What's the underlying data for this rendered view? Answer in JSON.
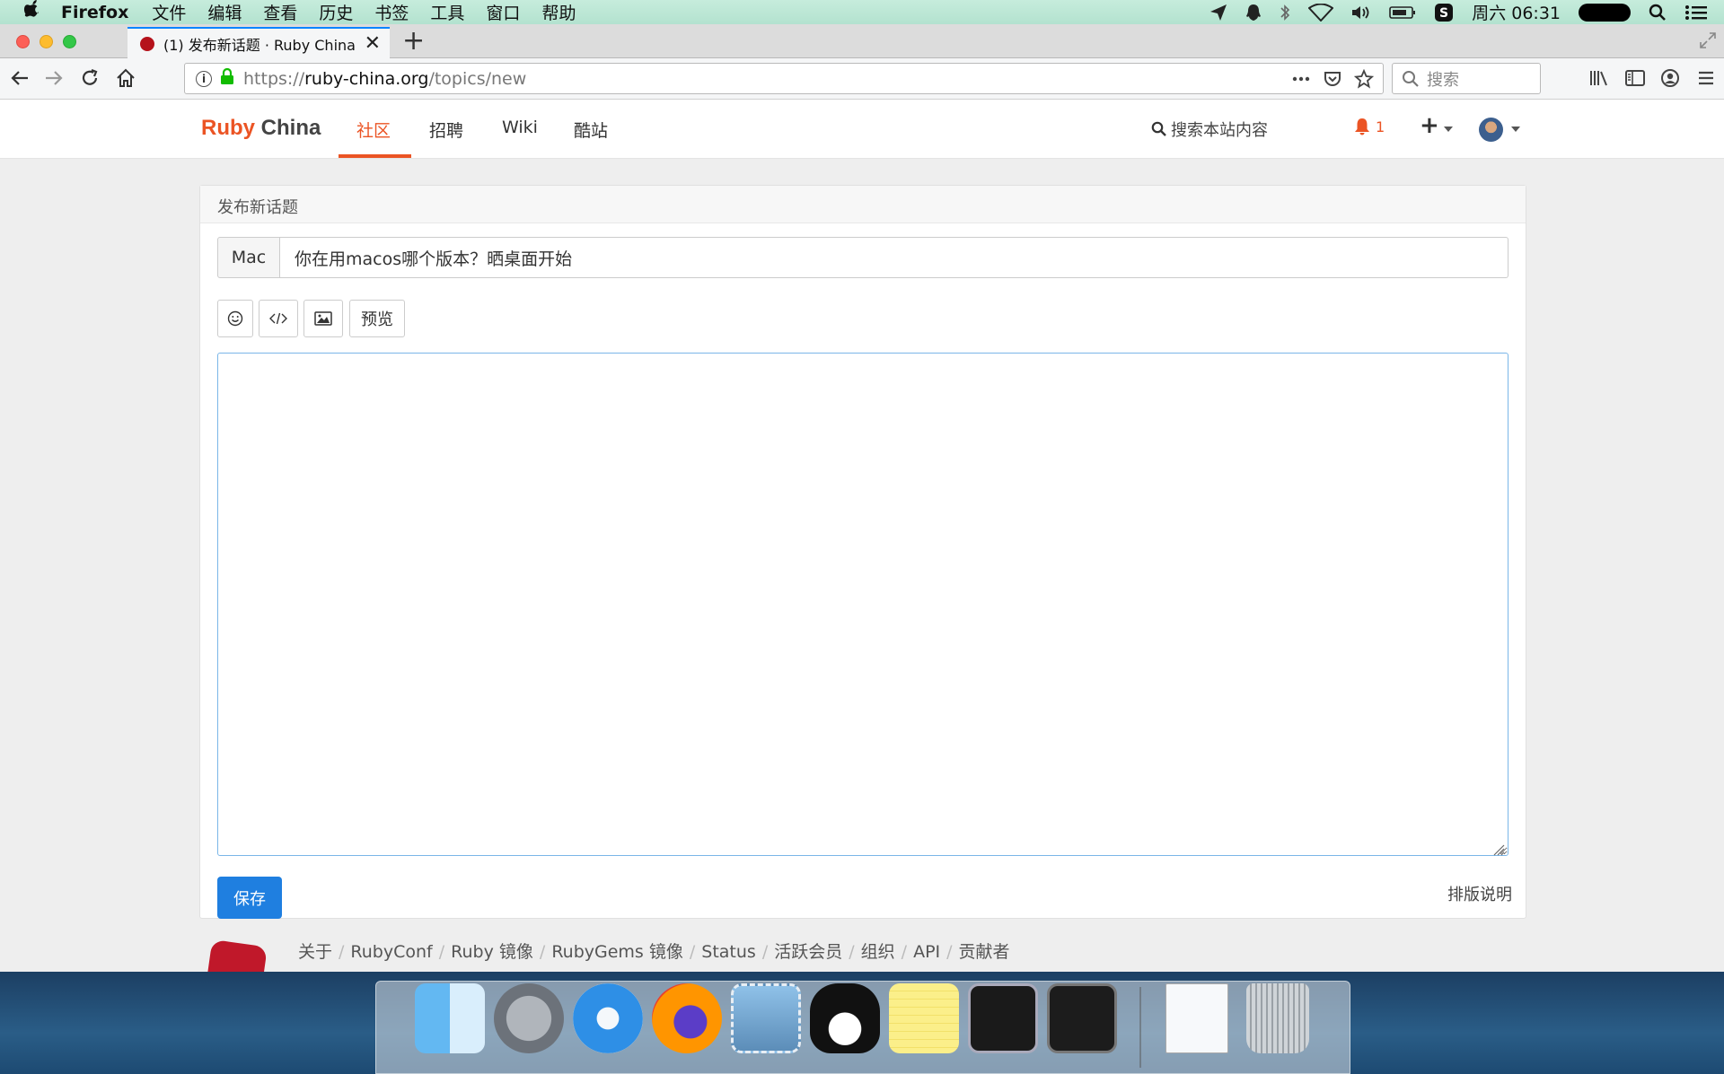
{
  "menubar": {
    "app_name": "Firefox",
    "menus": [
      "文件",
      "编辑",
      "查看",
      "历史",
      "书签",
      "工具",
      "窗口",
      "帮助"
    ],
    "clock": "周六 06:31"
  },
  "tab": {
    "title": "(1) 发布新话题 · Ruby China"
  },
  "urlbar": {
    "scheme": "https://",
    "host": "ruby-china.org",
    "path": "/topics/new"
  },
  "searchbar": {
    "placeholder": "搜索"
  },
  "site": {
    "brand_ruby": "Ruby",
    "brand_china": "China",
    "nav": [
      "社区",
      "招聘",
      "Wiki",
      "酷站"
    ],
    "search_label": "搜索本站内容",
    "notification_count": "1"
  },
  "form": {
    "card_title": "发布新话题",
    "node": "Mac",
    "title_value": "你在用macos哪个版本？晒桌面开始",
    "preview_label": "预览",
    "save_label": "保存",
    "format_help": "排版说明"
  },
  "footer": {
    "links": [
      "关于",
      "RubyConf",
      "Ruby 镜像",
      "RubyGems 镜像",
      "Status",
      "活跃会员",
      "组织",
      "API",
      "贡献者"
    ]
  },
  "colors": {
    "accent": "#eb5424",
    "primary_button": "#1f7fe0",
    "firefox_tab_highlight": "#0a84ff"
  },
  "dock": {
    "apps": [
      "finder-icon",
      "launchpad-icon",
      "safari-icon",
      "firefox-icon",
      "mail-icon",
      "qq-icon",
      "stickies-icon",
      "activity-monitor-icon",
      "terminal-icon",
      "sql-document-icon",
      "trash-icon"
    ]
  }
}
